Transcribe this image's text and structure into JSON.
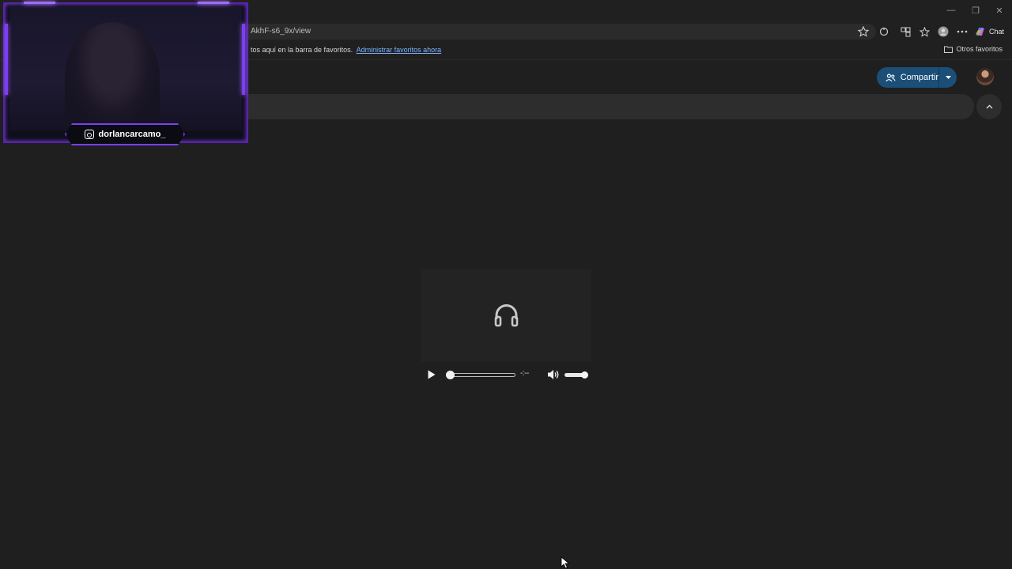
{
  "browser": {
    "url": "AkhF-s6_9x/view",
    "chat_label": "Chat",
    "favorites_hint": "tos aquí en la barra de favoritos.",
    "favorites_link": "Administrar favoritos ahora",
    "other_favorites": "Otros favoritos"
  },
  "drive": {
    "share_label": "Compartir"
  },
  "player": {
    "time": "-:--",
    "progress": 0,
    "volume": 1
  },
  "webcam": {
    "handle": "dorlancarcamo_"
  },
  "colors": {
    "share_button": "#1b4f78",
    "neon": "#7b3ff2",
    "link": "#7cb3ff"
  }
}
